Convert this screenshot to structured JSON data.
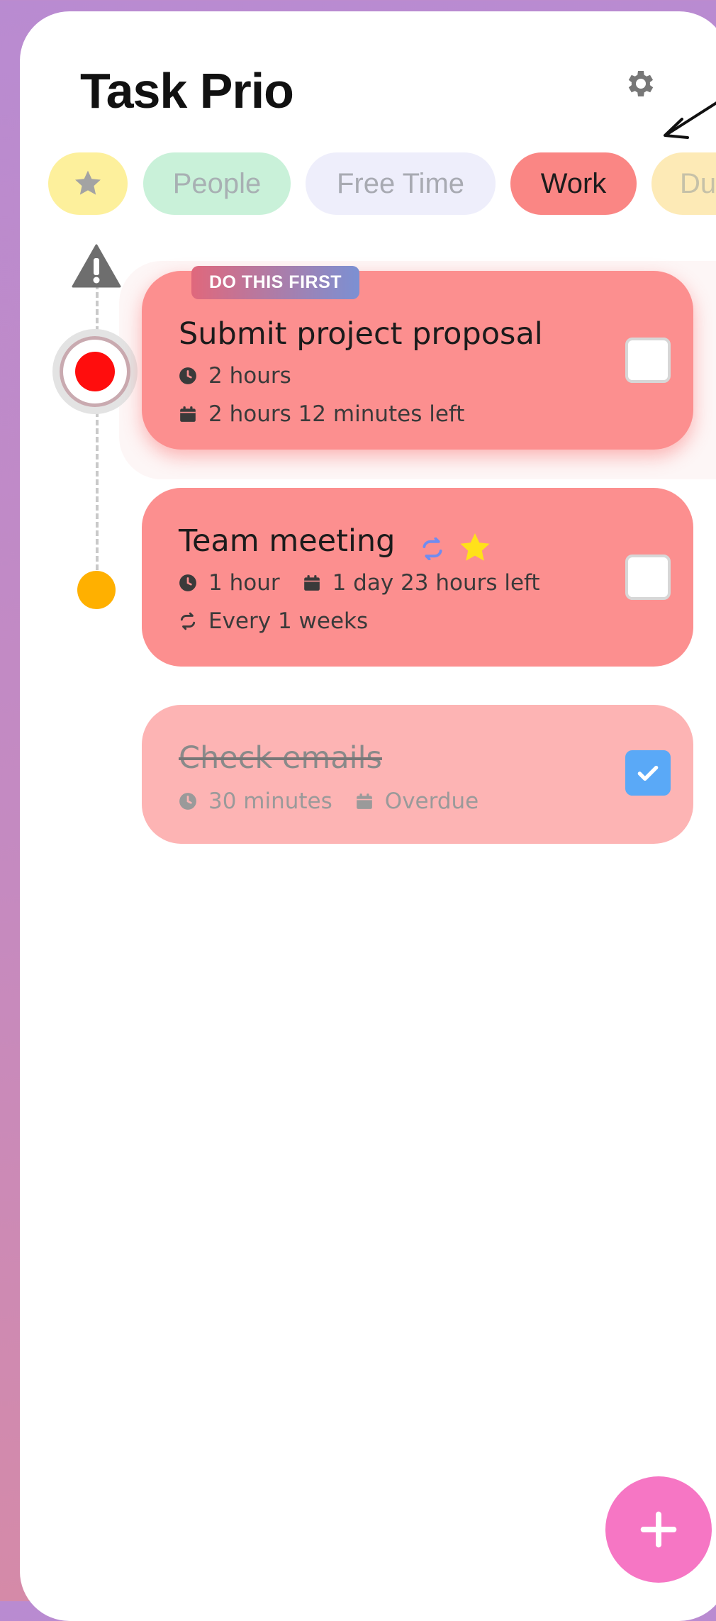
{
  "app": {
    "title": "Task Prio"
  },
  "categories": [
    {
      "label": "",
      "icon": "star-icon",
      "color": "#fdf09c"
    },
    {
      "label": "People",
      "color": "#c9f1d9"
    },
    {
      "label": "Free Time",
      "color": "#eeeefb"
    },
    {
      "label": "Work",
      "color": "#fa8684",
      "selected": true
    },
    {
      "label": "Du",
      "color": "#fdeab6"
    }
  ],
  "tasks": [
    {
      "badge": "DO THIS FIRST",
      "title": "Submit project proposal",
      "duration": "2 hours",
      "due": "2 hours 12 minutes left",
      "done": false,
      "node_color": "#ff0d0d"
    },
    {
      "title": "Team meeting",
      "duration": "1 hour",
      "due": "1 day 23 hours left",
      "repeat": "Every 1 weeks",
      "recurring_icon": "repeat-icon",
      "favorite_icon": "star-icon",
      "done": false,
      "node_color": "#ffb000"
    },
    {
      "title": "Check emails",
      "duration": "30 minutes",
      "due": "Overdue",
      "done": true
    }
  ],
  "colors": {
    "accent": "#f676c4",
    "work": "#fc8f8f",
    "checkbox_checked": "#5aa9f7"
  }
}
